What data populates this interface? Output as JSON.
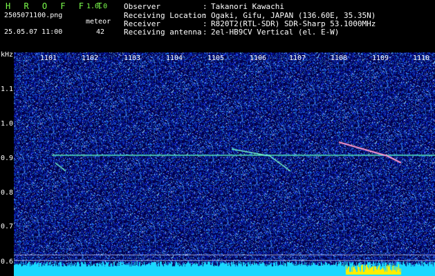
{
  "header": {
    "app_title": "H R O F F T",
    "app_version": "1.0.0",
    "filename": "2505071100.png",
    "datetime": "25.05.07 11:00",
    "meteor_label": "meteor",
    "meteor_count": "42",
    "info": [
      {
        "label": "Observer",
        "value": "Takanori Kawachi"
      },
      {
        "label": "Receiving Location",
        "value": "Ogaki, Gifu, JAPAN (136.60E, 35.35N)"
      },
      {
        "label": "Receiver",
        "value": "R820T2(RTL-SDR) SDR-Sharp 53.1000MHz"
      },
      {
        "label": "Receiving antenna",
        "value": "2el-HB9CV Vertical (el. E-W)"
      }
    ],
    "separator": ":"
  },
  "axes": {
    "y_unit": "kHz",
    "x_ticks": [
      "1101",
      "1102",
      "1103",
      "1104",
      "1105",
      "1106",
      "1107",
      "1108",
      "1109",
      "1110"
    ],
    "y_ticks": [
      "1.1",
      "1.0",
      "0.9",
      "0.8",
      "0.7",
      "0.6"
    ]
  },
  "colors": {
    "background": "#000000",
    "plot_background": "#020046",
    "title_green": "#7CFF4C",
    "signal_line": "#4cd6b4",
    "level_bar": "#19d8ff",
    "level_peak": "#ffee00"
  }
}
